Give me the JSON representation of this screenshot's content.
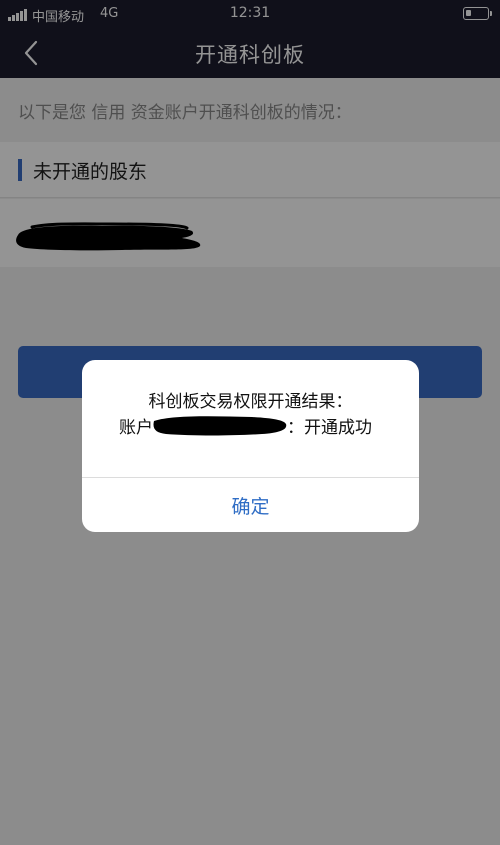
{
  "status_bar": {
    "carrier": "中国移动",
    "network": "4G",
    "time": "12:31"
  },
  "nav": {
    "title": "开通科创板",
    "back_icon": "chevron-left-icon"
  },
  "intro_text": "以下是您 信用 资金账户开通科创板的情况：",
  "section": {
    "title": "未开通的股东"
  },
  "dialog": {
    "line1": "科创板交易权限开通结果：",
    "account_label": "账户",
    "result_text": "：开通成功",
    "confirm_label": "确定"
  },
  "colors": {
    "nav_background": "#1c1c2e",
    "accent_blue": "#3a6bc5",
    "confirm_text": "#2f6dc5"
  }
}
